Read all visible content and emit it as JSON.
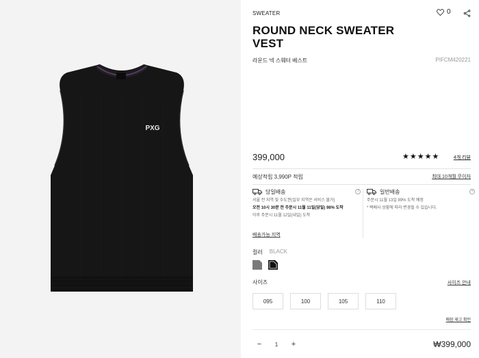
{
  "product": {
    "category": "SWEATER",
    "title": "ROUND NECK SWEATER VEST",
    "subname": "라운드 넥 스웨터 베스트",
    "code": "PIFCM420221",
    "wish_count": "0",
    "logo_text": "PXG",
    "price": "399,000",
    "rating_stars": "★★★★★",
    "review_link": "4개 리뷰",
    "mileage": "예상적립 3,990P 적립",
    "discount_link": "최대 10개월 무이자",
    "area_link": "배송가능 지역"
  },
  "shipping": {
    "same_day": {
      "title": "당일배송",
      "line1": "서울 전 지역 및 수도권(일부 지역은 서비스 불가)",
      "line2": "오전 10시 30분 전 주문시 11월 11일(당일) 98% 도착",
      "line3": "이후 주문시 11월 12일(내일) 도착"
    },
    "normal": {
      "title": "일반배송",
      "line1": "주문시 11월 13일 89% 도착 예정",
      "line2": "* 택배사 상황에 따라 변경될 수 있습니다."
    }
  },
  "options": {
    "color_label": "컬러",
    "color_value": "BLACK",
    "size_label": "사이즈",
    "size_guide": "사이즈 안내",
    "sizes": [
      "095",
      "100",
      "105",
      "110"
    ],
    "restock_link": "매장 재고 확인"
  },
  "order": {
    "minus": "−",
    "quantity": "1",
    "plus": "+",
    "total": "₩399,000"
  },
  "colors": {
    "swatch_grey": "#7a7a7a",
    "swatch_black": "#111111",
    "vest_body": "#161616"
  }
}
